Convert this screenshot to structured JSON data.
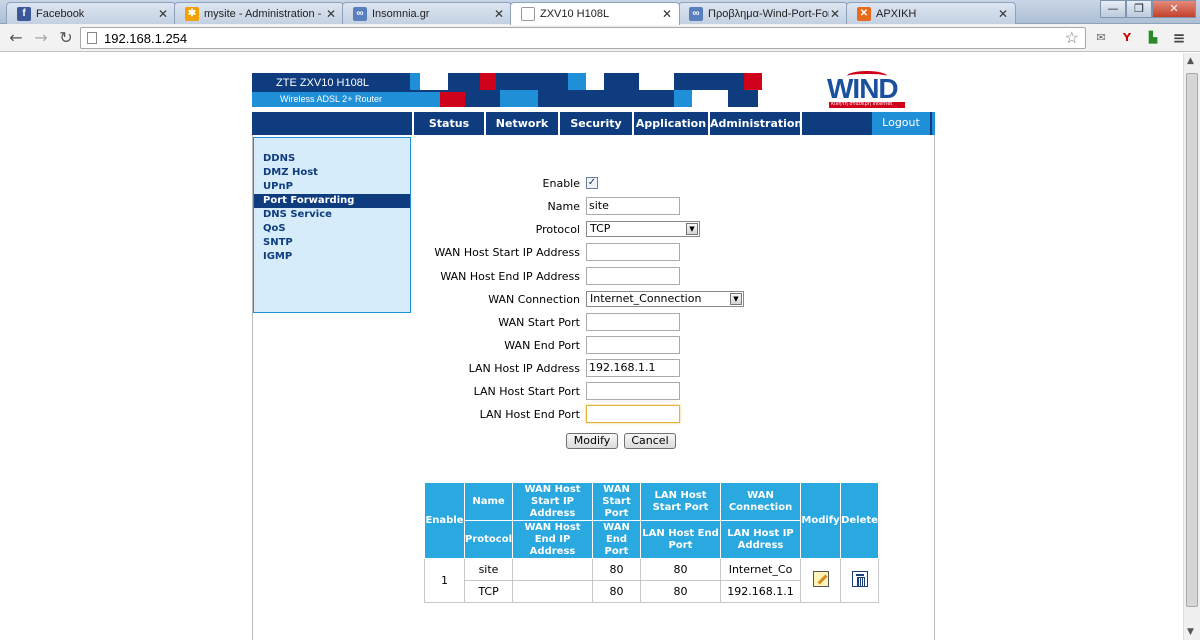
{
  "browser": {
    "tabs": [
      {
        "title": "Facebook",
        "favicon": "facebook-icon",
        "color": "#3b5998",
        "glyph": "f"
      },
      {
        "title": "mysite - Administration -",
        "favicon": "joomla-icon",
        "color": "#f4a000",
        "glyph": "✱"
      },
      {
        "title": "Insomnia.gr",
        "favicon": "insomnia-icon",
        "color": "#5a7fbf",
        "glyph": "∞"
      },
      {
        "title": "ZXV10 H108L",
        "favicon": "blank-page-icon",
        "color": "#ffffff",
        "glyph": ""
      },
      {
        "title": "Προβλημα-Wind-Port-For",
        "favicon": "insomnia-icon",
        "color": "#5a7fbf",
        "glyph": "∞"
      },
      {
        "title": "ΑΡΧΙΚΗ",
        "favicon": "site-icon",
        "color": "#e86a1a",
        "glyph": "✕"
      }
    ],
    "active_tab": 3,
    "url": "192.168.1.254"
  },
  "router": {
    "model": "ZTE ZXV10 H108L",
    "subtitle": "Wireless ADSL 2+ Router",
    "logo_text": "WIND",
    "logo_tagline": "κινητή σταθερή Internet",
    "menu": [
      "Status",
      "Network",
      "Security",
      "Application",
      "Administration"
    ],
    "logout": "Logout",
    "sidebar": [
      "DDNS",
      "DMZ Host",
      "UPnP",
      "Port Forwarding",
      "DNS Service",
      "QoS",
      "SNTP",
      "IGMP"
    ],
    "sidebar_active": "Port Forwarding",
    "form": {
      "enable_label": "Enable",
      "enable_checked": true,
      "name_label": "Name",
      "name_value": "site",
      "protocol_label": "Protocol",
      "protocol_value": "TCP",
      "wan_start_ip_label": "WAN Host Start IP Address",
      "wan_start_ip_value": "",
      "wan_end_ip_label": "WAN Host End IP Address",
      "wan_end_ip_value": "",
      "wan_connection_label": "WAN Connection",
      "wan_connection_value": "Internet_Connection",
      "wan_start_port_label": "WAN Start Port",
      "wan_start_port_value": "",
      "wan_end_port_label": "WAN End Port",
      "wan_end_port_value": "",
      "lan_ip_label": "LAN Host IP Address",
      "lan_ip_value": "192.168.1.1",
      "lan_start_port_label": "LAN Host Start Port",
      "lan_start_port_value": "",
      "lan_end_port_label": "LAN Host End Port",
      "lan_end_port_value": "",
      "modify_button": "Modify",
      "cancel_button": "Cancel"
    },
    "table": {
      "headers": {
        "enable": "Enable",
        "name": "Name",
        "protocol": "Protocol",
        "wan_start_ip": "WAN Host Start IP Address",
        "wan_end_ip": "WAN Host End IP Address",
        "wan_start_port": "WAN Start Port",
        "wan_end_port": "WAN End Port",
        "lan_start_port": "LAN Host Start Port",
        "lan_end_port": "LAN Host End Port",
        "wan_connection": "WAN Connection",
        "lan_ip": "LAN Host IP Address",
        "modify": "Modify",
        "delete": "Delete"
      },
      "row": {
        "index": "1",
        "name": "site",
        "protocol": "TCP",
        "wan_start_ip": "",
        "wan_end_ip": "",
        "wan_start_port": "80",
        "wan_end_port": "80",
        "lan_start_port": "80",
        "lan_end_port": "80",
        "wan_connection": "Internet_Co",
        "lan_ip": "192.168.1.1"
      }
    }
  }
}
